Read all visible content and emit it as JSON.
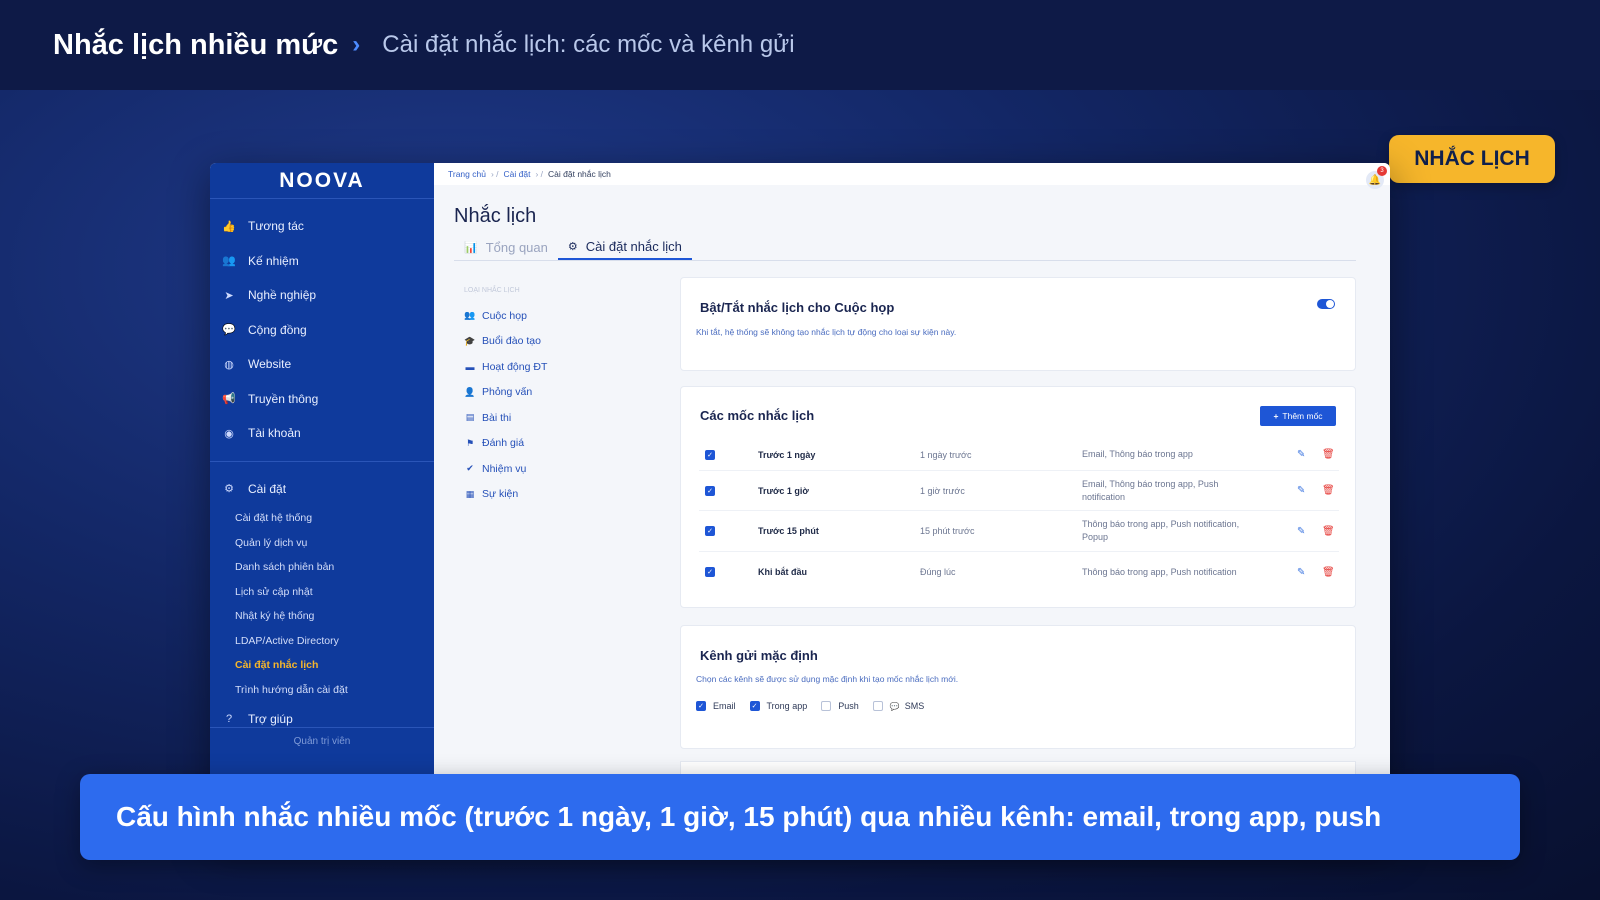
{
  "header": {
    "title": "Nhắc lịch nhiều mức",
    "separator": "›",
    "subtitle": "Cài đặt nhắc lịch: các mốc và kênh gửi"
  },
  "badge": "NHẮC LỊCH",
  "caption": "Cấu hình nhắc nhiều mốc (trước 1 ngày, 1 giờ, 15 phút) qua nhiều kênh: email, trong app, push",
  "colors": {
    "accent": "#1e56d6",
    "sidebar": "#0f3a9c",
    "highlight": "#f6b62b",
    "caption": "#2d6bee",
    "danger": "#e53935"
  },
  "app": {
    "logo": "NOOVA",
    "sidebar": {
      "items": [
        {
          "label": "Tương tác",
          "icon": "thumbs-up-icon"
        },
        {
          "label": "Kế nhiệm",
          "icon": "users-icon"
        },
        {
          "label": "Nghề nghiệp",
          "icon": "rocket-icon"
        },
        {
          "label": "Cộng đồng",
          "icon": "comments-icon"
        },
        {
          "label": "Website",
          "icon": "globe-icon"
        },
        {
          "label": "Truyền thông",
          "icon": "megaphone-icon"
        },
        {
          "label": "Tài khoản",
          "icon": "user-circle-icon"
        }
      ],
      "settings": {
        "label": "Cài đặt",
        "icon": "gear-icon"
      },
      "sub_items": [
        "Cài đặt hệ thống",
        "Quản lý dịch vụ",
        "Danh sách phiên bản",
        "Lịch sử cập nhật",
        "Nhật ký hệ thống",
        "LDAP/Active Directory",
        "Cài đặt nhắc lịch",
        "Trình hướng dẫn cài đặt"
      ],
      "help": {
        "label": "Trợ giúp",
        "icon": "question-circle-icon"
      },
      "footer": "Quản trị viên"
    },
    "breadcrumb": {
      "home": "Trang chủ",
      "settings": "Cài đặt",
      "current": "Cài đặt nhắc lịch"
    },
    "notification_count": "3",
    "page_title": "Nhắc lịch",
    "tabs": [
      {
        "label": "Tổng quan",
        "icon": "chart-icon"
      },
      {
        "label": "Cài đặt nhắc lịch",
        "icon": "gear-icon"
      }
    ],
    "event_types_header": "LOẠI NHẮC LỊCH",
    "event_types": [
      {
        "label": "Cuộc họp",
        "icon": "users-icon"
      },
      {
        "label": "Buổi đào tạo",
        "icon": "graduation-cap-icon"
      },
      {
        "label": "Hoạt động ĐT",
        "icon": "book-icon"
      },
      {
        "label": "Phỏng vấn",
        "icon": "user-icon"
      },
      {
        "label": "Bài thi",
        "icon": "file-icon"
      },
      {
        "label": "Đánh giá",
        "icon": "flag-icon"
      },
      {
        "label": "Nhiệm vụ",
        "icon": "check-icon"
      },
      {
        "label": "Sự kiện",
        "icon": "calendar-icon"
      }
    ],
    "toggle_card": {
      "title": "Bật/Tắt nhắc lịch cho Cuộc họp",
      "desc": "Khi tắt, hệ thống sẽ không tạo nhắc lịch tự động cho loại sự kiện này."
    },
    "milestones_card": {
      "title": "Các mốc nhắc lịch",
      "add_label": "Thêm mốc",
      "rows": [
        {
          "name": "Trước 1 ngày",
          "time": "1 ngày trước",
          "channels": "Email, Thông báo trong app"
        },
        {
          "name": "Trước 1 giờ",
          "time": "1 giờ trước",
          "channels": "Email, Thông báo trong app, Push notification"
        },
        {
          "name": "Trước 15 phút",
          "time": "15 phút trước",
          "channels": "Thông báo trong app, Push notification, Popup"
        },
        {
          "name": "Khi bắt đầu",
          "time": "Đúng lúc",
          "channels": "Thông báo trong app, Push notification"
        }
      ]
    },
    "channels_card": {
      "title": "Kênh gửi mặc định",
      "desc": "Chọn các kênh sẽ được sử dụng mặc định khi tạo mốc nhắc lịch mới.",
      "options": [
        {
          "label": "Email",
          "checked": true
        },
        {
          "label": "Trong app",
          "checked": true
        },
        {
          "label": "Push",
          "checked": false
        },
        {
          "label": "SMS",
          "checked": false
        }
      ]
    }
  }
}
